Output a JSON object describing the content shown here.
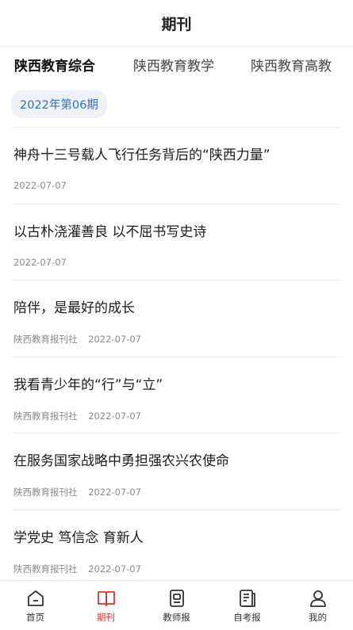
{
  "header": {
    "title": "期刊"
  },
  "tabs": [
    {
      "label": "陕西教育综合",
      "active": true
    },
    {
      "label": "陕西教育教学",
      "active": false
    },
    {
      "label": "陕西教育高教",
      "active": false
    }
  ],
  "issue": {
    "label": "2022年第06期"
  },
  "articles": [
    {
      "title": "神舟十三号载人飞行任务背后的“陕西力量”",
      "source": "",
      "date": "2022-07-07"
    },
    {
      "title": "以古朴浇灌善良 以不屈书写史诗",
      "source": "",
      "date": "2022-07-07"
    },
    {
      "title": "陪伴，是最好的成长",
      "source": "陕西教育报刊社",
      "date": "2022-07-07"
    },
    {
      "title": "我看青少年的“行”与“立”",
      "source": "陕西教育报刊社",
      "date": "2022-07-07"
    },
    {
      "title": "在服务国家战略中勇担强农兴农使命",
      "source": "陕西教育报刊社",
      "date": "2022-07-07"
    },
    {
      "title": "学党史 笃信念 育新人",
      "source": "陕西教育报刊社",
      "date": "2022-07-07"
    }
  ],
  "nav": [
    {
      "label": "首页",
      "icon": "home-icon",
      "active": false
    },
    {
      "label": "期刊",
      "icon": "book-icon",
      "active": true
    },
    {
      "label": "教师报",
      "icon": "teacher-paper-icon",
      "active": false
    },
    {
      "label": "自考报",
      "icon": "exam-paper-icon",
      "active": false
    },
    {
      "label": "我的",
      "icon": "user-icon",
      "active": false
    }
  ],
  "colors": {
    "accent": "#e0302d",
    "issue_text": "#2f6fc4",
    "issue_bg": "#eef2f8"
  }
}
